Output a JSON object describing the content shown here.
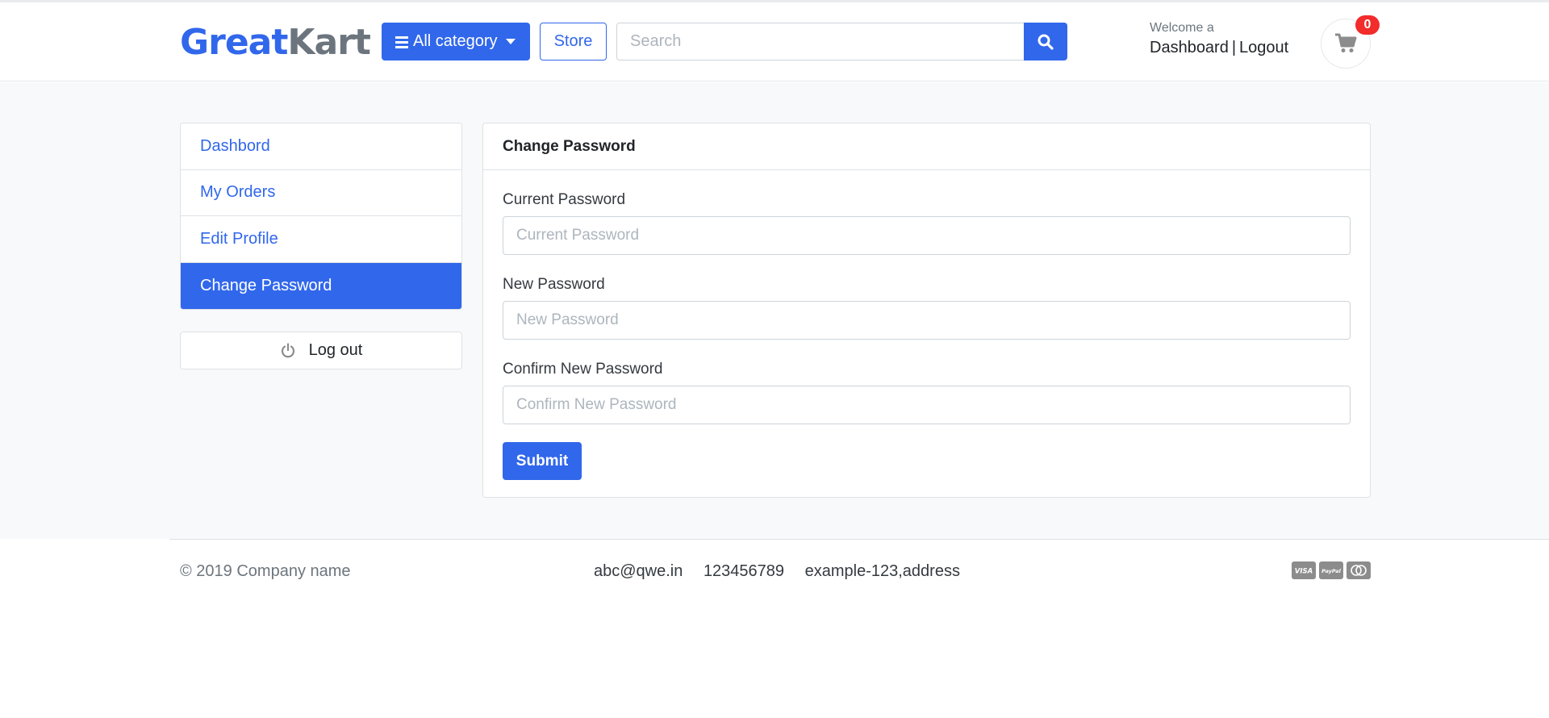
{
  "brand": {
    "part1": "Great",
    "part2": "Kart"
  },
  "header": {
    "category_label": "All category",
    "store_label": "Store",
    "search_placeholder": "Search",
    "welcome_text": "Welcome a",
    "dashboard_link": "Dashboard",
    "separator": "|",
    "logout_link": "Logout",
    "cart_count": "0"
  },
  "sidebar": {
    "items": [
      {
        "label": "Dashbord",
        "active": false
      },
      {
        "label": "My Orders",
        "active": false
      },
      {
        "label": "Edit Profile",
        "active": false
      },
      {
        "label": "Change Password",
        "active": true
      }
    ],
    "logout_label": "Log out"
  },
  "form": {
    "title": "Change Password",
    "current": {
      "label": "Current Password",
      "placeholder": "Current Password",
      "value": ""
    },
    "new": {
      "label": "New Password",
      "placeholder": "New Password",
      "value": ""
    },
    "confirm": {
      "label": "Confirm New Password",
      "placeholder": "Confirm New Password",
      "value": ""
    },
    "submit_label": "Submit"
  },
  "footer": {
    "copyright": "© 2019 Company name",
    "email": "abc@qwe.in",
    "phone": "123456789",
    "address": "example-123,address",
    "payment_icons": [
      "visa-icon",
      "paypal-icon",
      "mastercard-icon"
    ]
  },
  "colors": {
    "primary": "#3167eb",
    "muted": "#6c757d",
    "badge": "#f22b2b",
    "background": "#f8f9fa"
  }
}
